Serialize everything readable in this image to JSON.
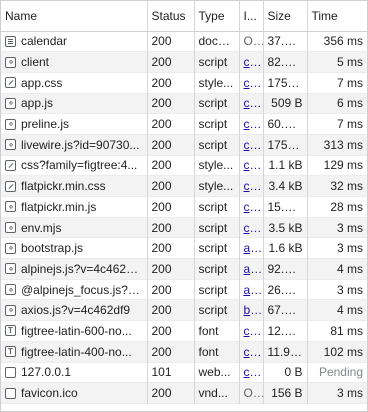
{
  "columns": {
    "name": "Name",
    "status": "Status",
    "type": "Type",
    "initiator": "I...",
    "size": "Size",
    "time": "Time"
  },
  "rows": [
    {
      "name": "calendar",
      "icon": "document-icon",
      "status": "200",
      "type": "docu...",
      "initiator": "O...",
      "size": "37.2 ...",
      "time": "356 ms"
    },
    {
      "name": "client",
      "icon": "script-icon",
      "status": "200",
      "type": "script",
      "initiator": "c...",
      "size": "82.8 ...",
      "time": "5 ms"
    },
    {
      "name": "app.css",
      "icon": "stylesheet-icon",
      "status": "200",
      "type": "style...",
      "initiator": "c...",
      "size": "175 kB",
      "time": "7 ms"
    },
    {
      "name": "app.js",
      "icon": "script-icon",
      "status": "200",
      "type": "script",
      "initiator": "c...",
      "size": "509 B",
      "time": "6 ms"
    },
    {
      "name": "preline.js",
      "icon": "script-icon",
      "status": "200",
      "type": "script",
      "initiator": "c...",
      "size": "60.0 ...",
      "time": "7 ms"
    },
    {
      "name": "livewire.js?id=90730...",
      "icon": "script-icon",
      "status": "200",
      "type": "script",
      "initiator": "c...",
      "size": "175 kB",
      "time": "313 ms"
    },
    {
      "name": "css?family=figtree:4...",
      "icon": "stylesheet-icon",
      "status": "200",
      "type": "style...",
      "initiator": "c...",
      "size": "1.1 kB",
      "time": "129 ms"
    },
    {
      "name": "flatpickr.min.css",
      "icon": "stylesheet-icon",
      "status": "200",
      "type": "style...",
      "initiator": "c...",
      "size": "3.4 kB",
      "time": "32 ms"
    },
    {
      "name": "flatpickr.min.js",
      "icon": "script-icon",
      "status": "200",
      "type": "script",
      "initiator": "c...",
      "size": "15.2 ...",
      "time": "28 ms"
    },
    {
      "name": "env.mjs",
      "icon": "script-icon",
      "status": "200",
      "type": "script",
      "initiator": "c...",
      "size": "3.5 kB",
      "time": "3 ms"
    },
    {
      "name": "bootstrap.js",
      "icon": "script-icon",
      "status": "200",
      "type": "script",
      "initiator": "a...",
      "size": "1.6 kB",
      "time": "3 ms"
    },
    {
      "name": "alpinejs.js?v=4c462d...",
      "icon": "script-icon",
      "status": "200",
      "type": "script",
      "initiator": "a...",
      "size": "92.5 ...",
      "time": "4 ms"
    },
    {
      "name": "@alpinejs_focus.js?v...",
      "icon": "script-icon",
      "status": "200",
      "type": "script",
      "initiator": "a...",
      "size": "26.9 ...",
      "time": "3 ms"
    },
    {
      "name": "axios.js?v=4c462df9",
      "icon": "script-icon",
      "status": "200",
      "type": "script",
      "initiator": "b...",
      "size": "67.2 ...",
      "time": "4 ms"
    },
    {
      "name": "figtree-latin-600-no...",
      "icon": "font-icon",
      "status": "200",
      "type": "font",
      "initiator": "c...",
      "size": "12.1 ...",
      "time": "81 ms"
    },
    {
      "name": "figtree-latin-400-no...",
      "icon": "font-icon",
      "status": "200",
      "type": "font",
      "initiator": "c...",
      "size": "11.9 ...",
      "time": "102 ms"
    },
    {
      "name": "127.0.0.1",
      "icon": "blank-file-icon",
      "status": "101",
      "type": "web...",
      "initiator": "c...",
      "size": "0 B",
      "time": "Pending"
    },
    {
      "name": "favicon.ico",
      "icon": "blank-file-icon",
      "status": "200",
      "type": "vnd...",
      "initiator": "O...",
      "size": "156 B",
      "time": "3 ms"
    }
  ]
}
